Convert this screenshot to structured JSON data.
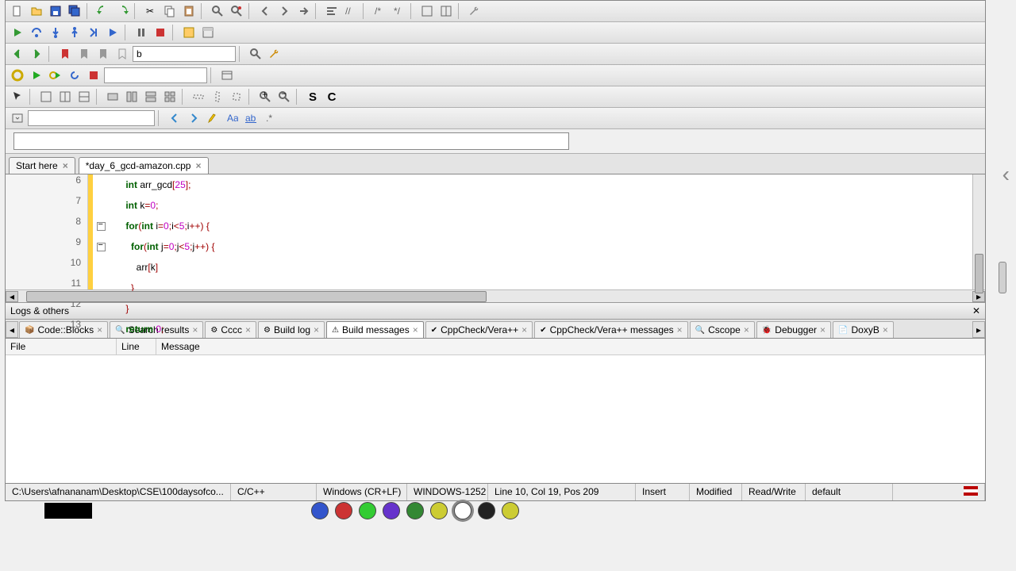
{
  "toolbar_search_value": "b",
  "tabs": [
    {
      "label": "Start here",
      "active": false
    },
    {
      "label": "*day_6_gcd-amazon.cpp",
      "active": true
    }
  ],
  "code": {
    "lines": [
      {
        "n": 6,
        "indent": 2,
        "tokens": [
          [
            "kw",
            "int"
          ],
          [
            "",
            ""
          ],
          [
            "",
            "arr_gcd"
          ],
          [
            "op",
            "["
          ],
          [
            "num",
            "25"
          ],
          [
            "op",
            "];"
          ]
        ]
      },
      {
        "n": 7,
        "indent": 2,
        "tokens": [
          [
            "kw",
            "int"
          ],
          [
            "",
            ""
          ],
          [
            "",
            "k"
          ],
          [
            "op",
            "="
          ],
          [
            "num",
            "0"
          ],
          [
            "op",
            ";"
          ]
        ]
      },
      {
        "n": 8,
        "indent": 2,
        "fold": true,
        "tokens": [
          [
            "kw",
            "for"
          ],
          [
            "op",
            "("
          ],
          [
            "kw",
            "int"
          ],
          [
            "",
            ""
          ],
          [
            "",
            "i"
          ],
          [
            "op",
            "="
          ],
          [
            "num",
            "0"
          ],
          [
            "op",
            ";"
          ],
          [
            "",
            "i"
          ],
          [
            "op",
            "<"
          ],
          [
            "num",
            "5"
          ],
          [
            "op",
            ";"
          ],
          [
            "",
            "i"
          ],
          [
            "op",
            "++)"
          ],
          [
            "",
            ""
          ],
          [
            "op",
            "{"
          ]
        ]
      },
      {
        "n": 9,
        "indent": 3,
        "fold": true,
        "tokens": [
          [
            "kw",
            "for"
          ],
          [
            "op",
            "("
          ],
          [
            "kw",
            "int"
          ],
          [
            "",
            ""
          ],
          [
            "",
            "j"
          ],
          [
            "op",
            "="
          ],
          [
            "num",
            "0"
          ],
          [
            "op",
            ";"
          ],
          [
            "",
            "j"
          ],
          [
            "op",
            "<"
          ],
          [
            "num",
            "5"
          ],
          [
            "op",
            ";"
          ],
          [
            "",
            "j"
          ],
          [
            "op",
            "++)"
          ],
          [
            "",
            ""
          ],
          [
            "op",
            "{"
          ]
        ]
      },
      {
        "n": 10,
        "indent": 4,
        "tokens": [
          [
            "",
            "arr"
          ],
          [
            "op",
            "["
          ],
          [
            "",
            "k"
          ],
          [
            "op",
            "]"
          ]
        ]
      },
      {
        "n": 11,
        "indent": 3,
        "tokens": [
          [
            "op",
            "}"
          ]
        ]
      },
      {
        "n": 12,
        "indent": 2,
        "tokens": [
          [
            "op",
            "}"
          ]
        ]
      },
      {
        "n": 13,
        "indent": 2,
        "tokens": [
          [
            "kw",
            "return"
          ],
          [
            "",
            ""
          ],
          [
            "num",
            "0"
          ],
          [
            "op",
            ";"
          ]
        ]
      }
    ]
  },
  "logs_title": "Logs & others",
  "log_tabs": [
    "Code::Blocks",
    "Search results",
    "Cccc",
    "Build log",
    "Build messages",
    "CppCheck/Vera++",
    "CppCheck/Vera++ messages",
    "Cscope",
    "Debugger",
    "DoxyB"
  ],
  "log_active_tab": 4,
  "log_headers": [
    "File",
    "Line",
    "Message"
  ],
  "status": {
    "path": "C:\\Users\\afnananam\\Desktop\\CSE\\100daysofco...",
    "lang": "C/C++",
    "eol": "Windows (CR+LF)",
    "encoding": "WINDOWS-1252",
    "pos": "Line 10, Col 19, Pos 209",
    "insert": "Insert",
    "modified": "Modified",
    "rw": "Read/Write",
    "profile": "default"
  }
}
